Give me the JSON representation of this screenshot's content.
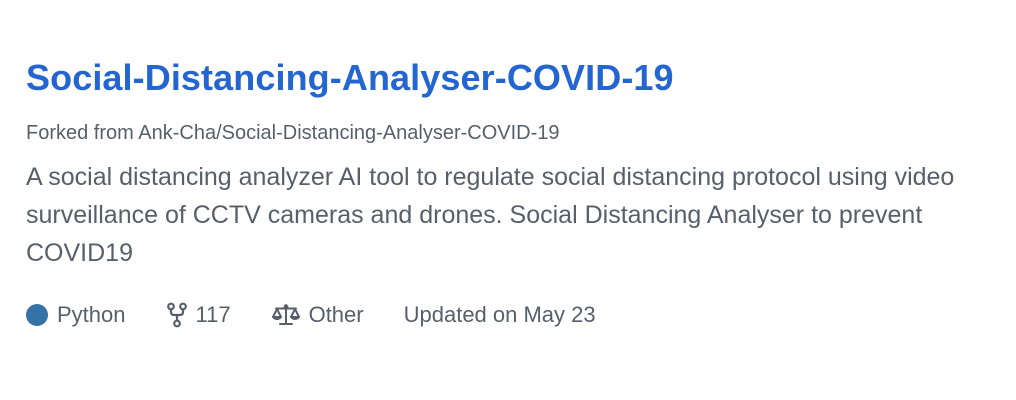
{
  "repo": {
    "name": "Social-Distancing-Analyser-COVID-19",
    "fork_prefix": "Forked from ",
    "fork_source": "Ank-Cha/Social-Distancing-Analyser-COVID-19",
    "description": "A social distancing analyzer AI tool to regulate social distancing protocol using video surveillance of CCTV cameras and drones. Social Distancing Analyser to prevent COVID19"
  },
  "meta": {
    "language": "Python",
    "language_color": "#3572a5",
    "language_icon": "language-color-dot",
    "forks": "117",
    "forks_icon": "fork-icon",
    "license": "Other",
    "license_icon": "law-scale-icon",
    "updated": "Updated on May 23"
  }
}
